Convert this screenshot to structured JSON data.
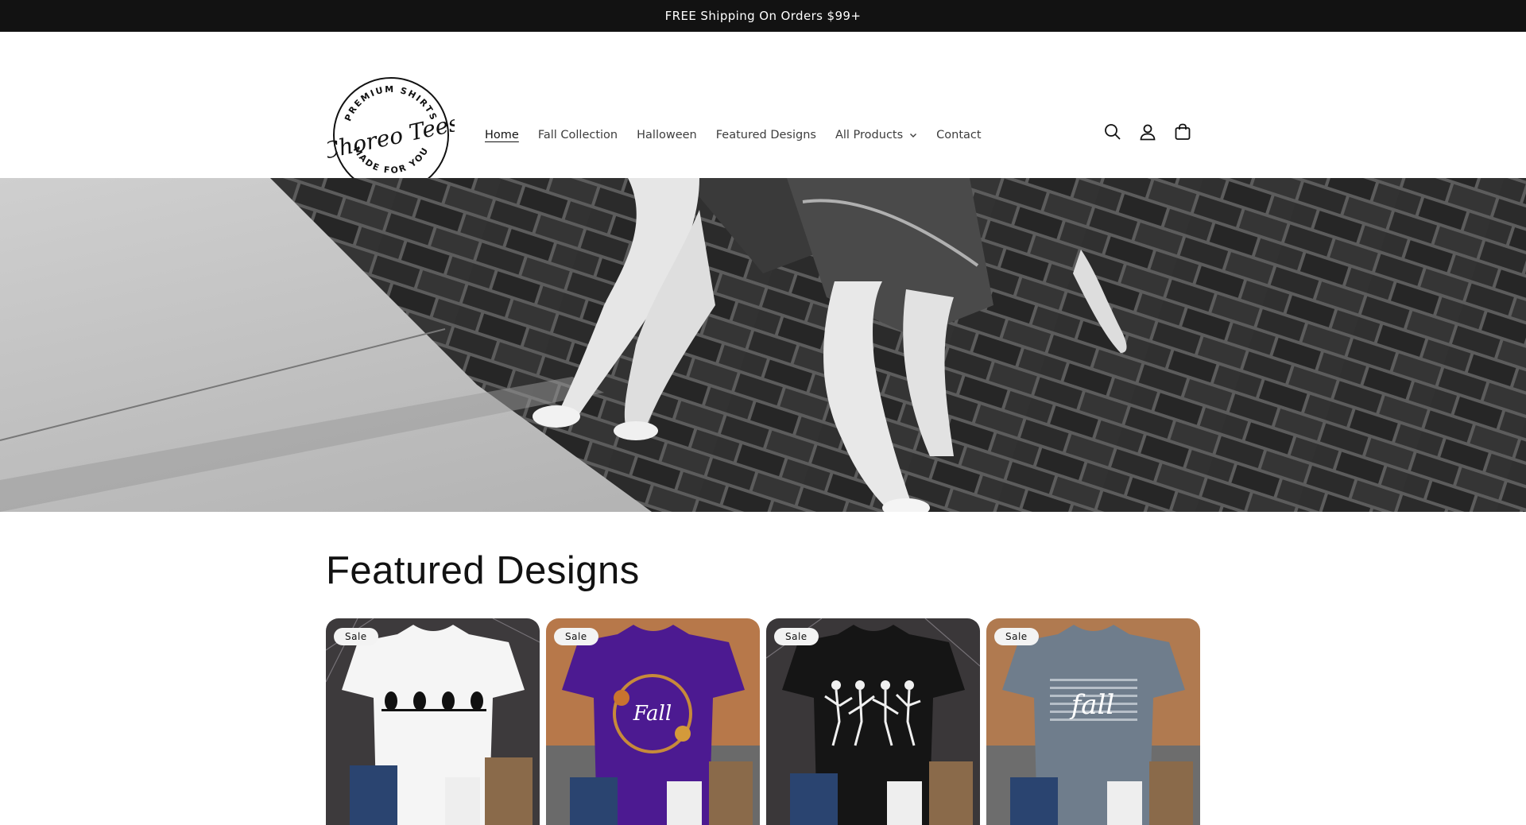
{
  "announcement": {
    "text": "FREE Shipping On Orders $99+"
  },
  "logo": {
    "top_text": "PREMIUM SHIRTS",
    "script_text": "Choreo Tees",
    "bottom_text": "MADE FOR YOU"
  },
  "nav": {
    "items": [
      {
        "label": "Home",
        "active": true
      },
      {
        "label": "Fall Collection"
      },
      {
        "label": "Halloween"
      },
      {
        "label": "Featured Designs"
      },
      {
        "label": "All Products",
        "has_dropdown": true
      },
      {
        "label": "Contact"
      }
    ]
  },
  "header_icons": [
    "search-icon",
    "account-icon",
    "cart-icon"
  ],
  "featured": {
    "title": "Featured Designs",
    "products": [
      {
        "badge": "Sale",
        "shirt_color": "#f5f5f5",
        "design": "ghosts"
      },
      {
        "badge": "Sale",
        "shirt_color": "#4c1a91",
        "design": "fall-wreath"
      },
      {
        "badge": "Sale",
        "shirt_color": "#151515",
        "design": "skeletons"
      },
      {
        "badge": "Sale",
        "shirt_color": "#6f7d8c",
        "design": "fall-words"
      }
    ]
  },
  "colors": {
    "announcement_bg": "#121212",
    "badge_bg": "#f3f3f3"
  }
}
